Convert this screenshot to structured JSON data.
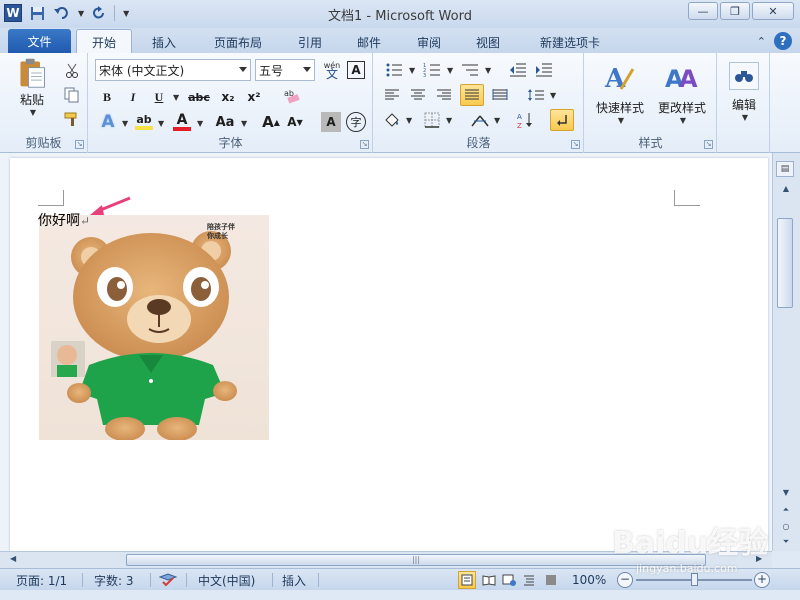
{
  "window": {
    "title": "文档1  -  Microsoft Word",
    "logo": "W"
  },
  "tabs": {
    "file": "文件",
    "items": [
      "开始",
      "插入",
      "页面布局",
      "引用",
      "邮件",
      "审阅",
      "视图",
      "新建选项卡"
    ]
  },
  "ribbon": {
    "clipboard": {
      "label": "剪贴板",
      "paste": "粘贴"
    },
    "font": {
      "label": "字体",
      "font_name": "宋体 (中文正文)",
      "font_size": "五号",
      "wen": "wén",
      "bold": "B",
      "italic": "I",
      "underline": "U",
      "strike": "abc",
      "sub": "x₂",
      "sup": "x²",
      "grow": "A",
      "shrink": "A",
      "case": "Aa",
      "char_border": "A",
      "enclose": "字"
    },
    "paragraph": {
      "label": "段落"
    },
    "styles": {
      "label": "样式",
      "quick_styles": "快速样式",
      "change_styles": "更改样式"
    },
    "editing": {
      "label": "编辑"
    }
  },
  "document": {
    "text": "你好啊",
    "paragraph_mark": "↵",
    "picture_caption": "陪孩子伴\n你成长"
  },
  "status": {
    "page": "页面: 1/1",
    "words": "字数: 3",
    "language": "中文(中国)",
    "mode": "插入",
    "zoom": "100%"
  },
  "watermark": {
    "brand": "Baidu经验",
    "url": "jingyan.baidu.com"
  },
  "colors": {
    "file_tab": "#2b6cc0",
    "highlight": "#f8e04a",
    "font_color": "#e41e26",
    "shirt_green": "#1fa34a",
    "bear_tan": "#d9a36a",
    "arrow": "#e8407a"
  }
}
